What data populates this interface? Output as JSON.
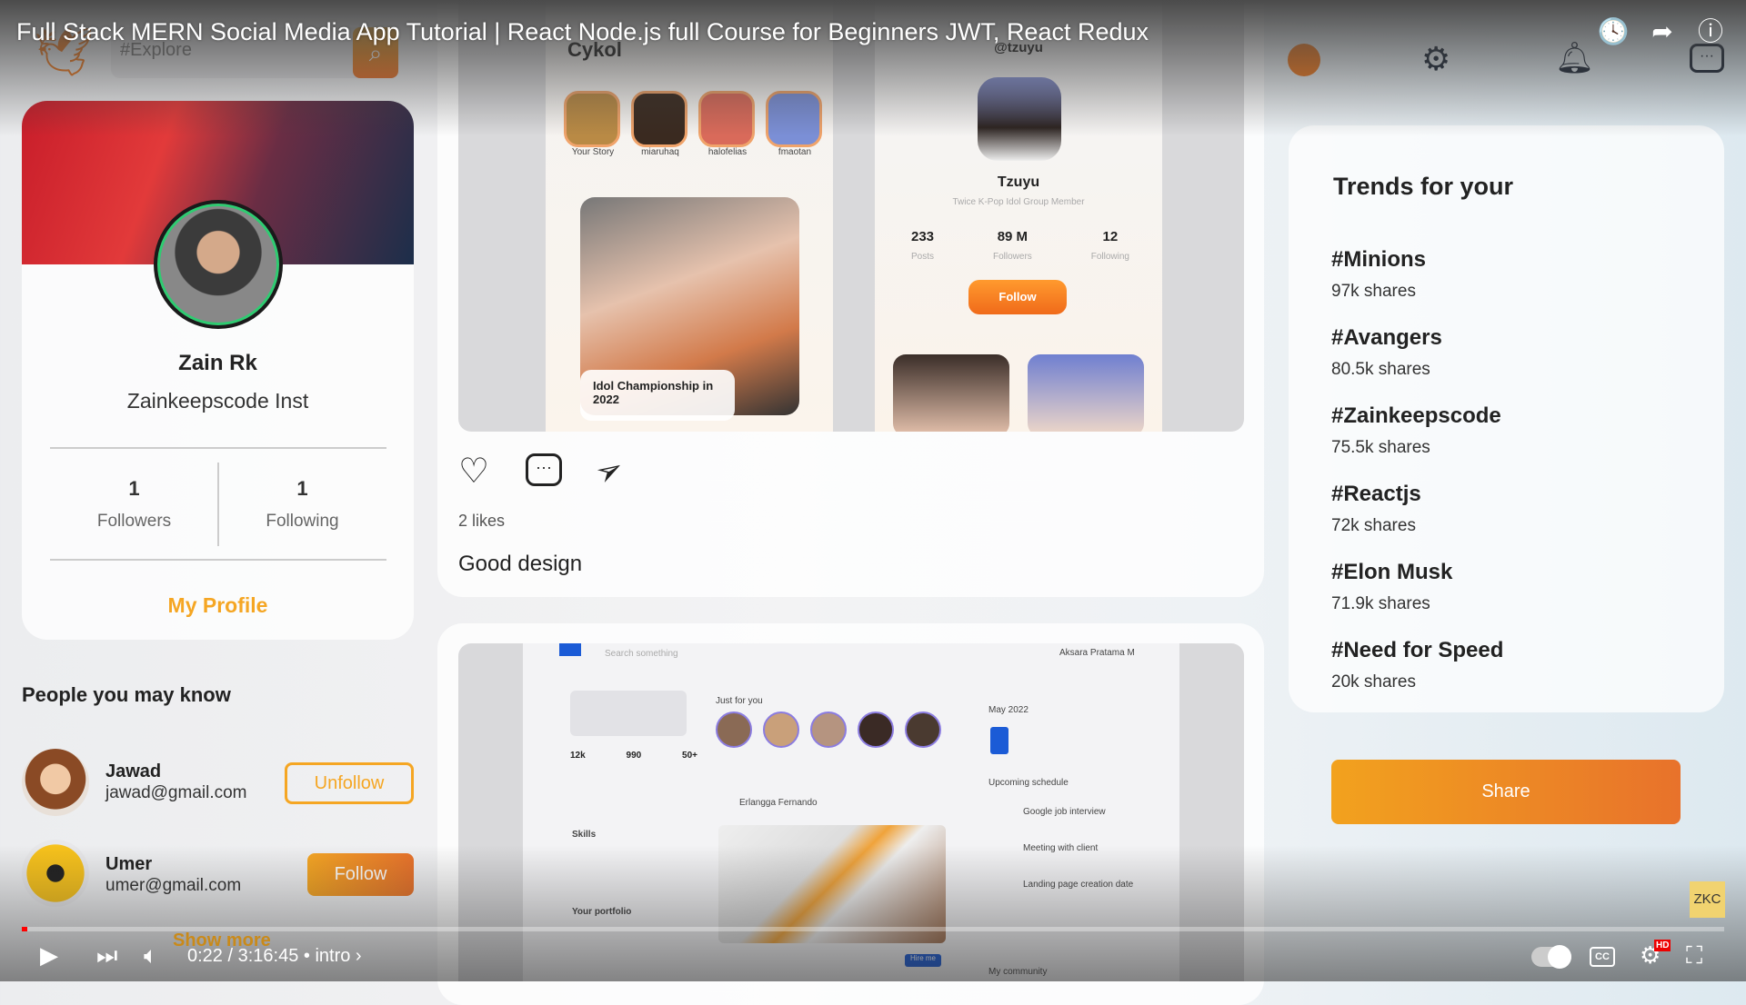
{
  "video": {
    "title": "Full Stack MERN Social Media App Tutorial | React Node.js full Course for Beginners JWT, React Redux",
    "time": "0:22 / 3:16:45",
    "chapter": "intro",
    "progress": 0.0019
  },
  "search": {
    "placeholder": "#Explore"
  },
  "profile": {
    "name": "Zain Rk",
    "subtitle": "Zainkeepscode Inst",
    "followers_count": "1",
    "followers_label": "Followers",
    "following_count": "1",
    "following_label": "Following",
    "link": "My Profile"
  },
  "people": {
    "heading": "People you may know",
    "items": [
      {
        "name": "Jawad",
        "email": "jawad@gmail.com",
        "action": "Unfollow"
      },
      {
        "name": "Umer",
        "email": "umer@gmail.com",
        "action": "Follow"
      }
    ],
    "show_more": "Show more"
  },
  "post": {
    "likes": "2 likes",
    "caption": "Good design",
    "mock": {
      "brand": "Cykol",
      "stories": [
        "Your Story",
        "miaruhaq",
        "halofelias",
        "fmaotan"
      ],
      "feature": "Idol Championship in 2022",
      "handle": "@tzuyu",
      "name": "Tzuyu",
      "bio": "Twice K-Pop Idol Group Member",
      "posts": "233",
      "posts_l": "Posts",
      "followers": "89 M",
      "followers_l": "Followers",
      "following": "12",
      "following_l": "Following",
      "follow": "Follow"
    }
  },
  "post2": {
    "search": "Search something",
    "user": "Aksara Pratama M",
    "just": "Just for you",
    "month": "May 2022",
    "schedule": "Upcoming schedule",
    "events": [
      "Google job interview",
      "Meeting with client",
      "Landing page creation date"
    ],
    "author": "Erlangga Fernando",
    "skills": "Skills",
    "portfolio": "Your portfolio",
    "stats": [
      "12k",
      "990",
      "50+"
    ],
    "hire": "Hire me",
    "community": "My community"
  },
  "trends": {
    "title": "Trends for your",
    "items": [
      {
        "tag": "#Minions",
        "shares": "97k shares"
      },
      {
        "tag": "#Avangers",
        "shares": "80.5k shares"
      },
      {
        "tag": "#Zainkeepscode",
        "shares": "75.5k shares"
      },
      {
        "tag": "#Reactjs",
        "shares": "72k shares"
      },
      {
        "tag": "#Elon Musk",
        "shares": "71.9k shares"
      },
      {
        "tag": "#Need for Speed",
        "shares": "20k shares"
      }
    ]
  },
  "share_label": "Share",
  "badge": "ZKC",
  "colors": {
    "orange": "#f5a623",
    "orange_dark": "#e8722b"
  }
}
